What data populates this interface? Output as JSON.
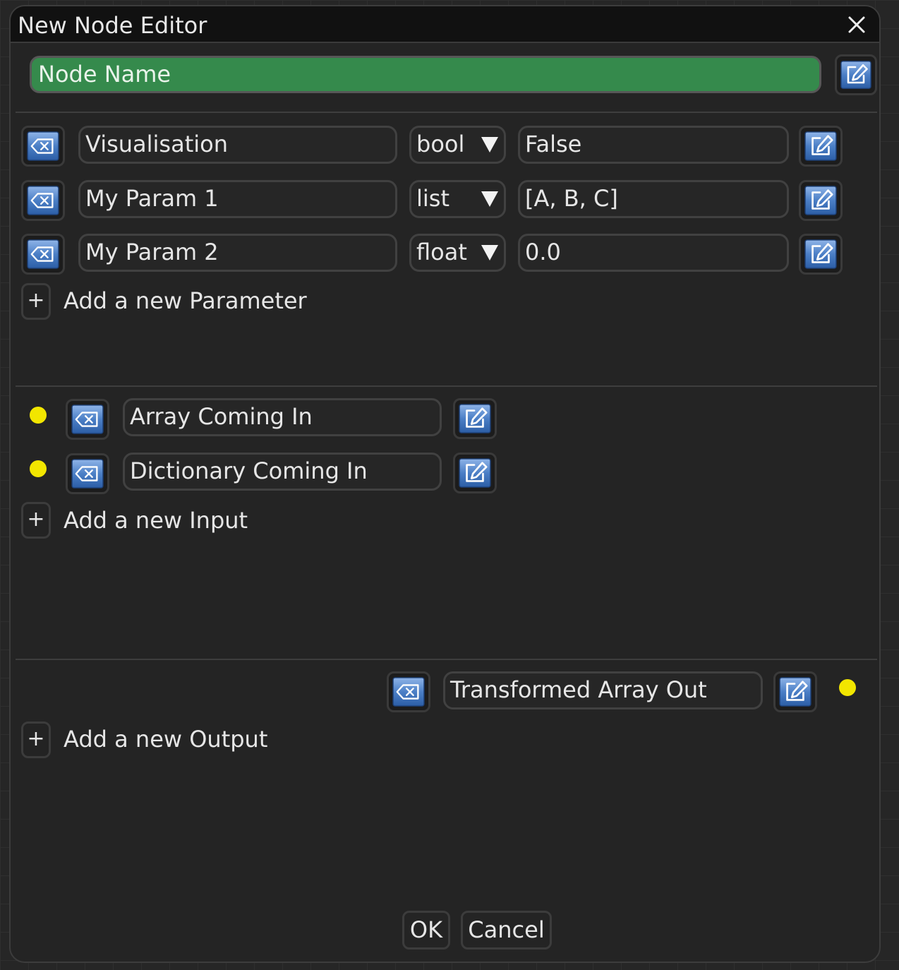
{
  "window": {
    "title": "New Node Editor"
  },
  "node": {
    "name": "Node Name"
  },
  "parameters": [
    {
      "name": "Visualisation",
      "type": "bool",
      "value": "False"
    },
    {
      "name": "My Param 1",
      "type": "list",
      "value": "[A, B, C]"
    },
    {
      "name": "My Param 2",
      "type": "float",
      "value": "0.0"
    }
  ],
  "inputs": [
    {
      "name": "Array Coming In"
    },
    {
      "name": "Dictionary Coming In"
    }
  ],
  "outputs": [
    {
      "name": "Transformed Array Out"
    }
  ],
  "add_buttons": {
    "symbol": "+",
    "parameter_label": "Add a new Parameter",
    "input_label": "Add a new Input",
    "output_label": "Add a new Output"
  },
  "footer": {
    "ok_label": "OK",
    "cancel_label": "Cancel"
  },
  "colors": {
    "node_name_bg": "#358a4c",
    "port_dot": "#f2e600",
    "icon_blue": "#4a7fc8"
  },
  "icons": {
    "delete": "backspace-icon",
    "edit": "edit-icon",
    "close": "close-icon"
  }
}
